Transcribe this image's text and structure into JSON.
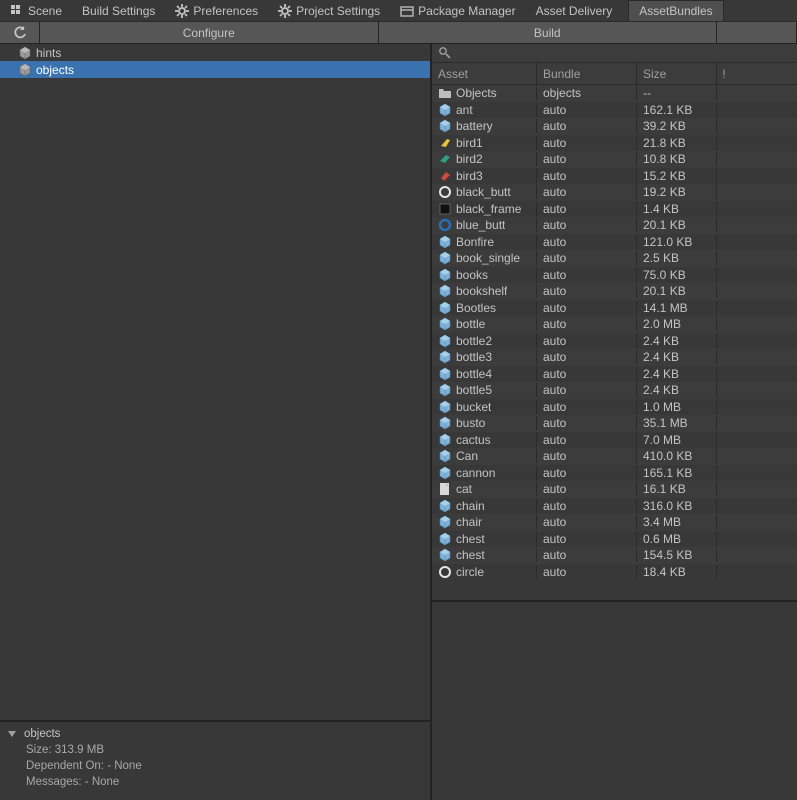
{
  "menu": {
    "scene": "Scene",
    "build_settings": "Build Settings",
    "preferences": "Preferences",
    "project_settings": "Project Settings",
    "package_manager": "Package Manager",
    "asset_delivery": "Asset Delivery",
    "asset_bundles": "AssetBundles"
  },
  "toolbar": {
    "configure": "Configure",
    "build": "Build"
  },
  "sidebar": {
    "items": [
      {
        "name": "hints",
        "selected": false
      },
      {
        "name": "objects",
        "selected": true
      }
    ]
  },
  "details": {
    "title": "objects",
    "size_label": "Size: 313.9 MB",
    "dependent_label": "Dependent On: - None",
    "messages_label": "Messages: - None"
  },
  "table": {
    "search_placeholder": "",
    "headers": {
      "asset": "Asset",
      "bundle": "Bundle",
      "size": "Size",
      "bang": "!"
    },
    "rows": [
      {
        "icon": "folder",
        "asset": "Objects",
        "bundle": "objects",
        "size": "--"
      },
      {
        "icon": "prefab",
        "asset": "ant",
        "bundle": "auto",
        "size": "162.1 KB"
      },
      {
        "icon": "prefab",
        "asset": "battery",
        "bundle": "auto",
        "size": "39.2 KB"
      },
      {
        "icon": "bird-yellow",
        "asset": "bird1",
        "bundle": "auto",
        "size": "21.8 KB"
      },
      {
        "icon": "bird-teal",
        "asset": "bird2",
        "bundle": "auto",
        "size": "10.8 KB"
      },
      {
        "icon": "bird-red",
        "asset": "bird3",
        "bundle": "auto",
        "size": "15.2 KB"
      },
      {
        "icon": "ring-white",
        "asset": "black_butt",
        "bundle": "auto",
        "size": "19.2 KB"
      },
      {
        "icon": "square-black",
        "asset": "black_frame",
        "bundle": "auto",
        "size": "1.4 KB"
      },
      {
        "icon": "ring-blue",
        "asset": "blue_butt",
        "bundle": "auto",
        "size": "20.1 KB"
      },
      {
        "icon": "prefab",
        "asset": "Bonfire",
        "bundle": "auto",
        "size": "121.0 KB"
      },
      {
        "icon": "prefab",
        "asset": "book_single",
        "bundle": "auto",
        "size": "2.5 KB"
      },
      {
        "icon": "prefab",
        "asset": "books",
        "bundle": "auto",
        "size": "75.0 KB"
      },
      {
        "icon": "prefab",
        "asset": "bookshelf",
        "bundle": "auto",
        "size": "20.1 KB"
      },
      {
        "icon": "prefab",
        "asset": "Bootles",
        "bundle": "auto",
        "size": "14.1 MB"
      },
      {
        "icon": "prefab",
        "asset": "bottle",
        "bundle": "auto",
        "size": "2.0 MB"
      },
      {
        "icon": "prefab",
        "asset": "bottle2",
        "bundle": "auto",
        "size": "2.4 KB"
      },
      {
        "icon": "prefab",
        "asset": "bottle3",
        "bundle": "auto",
        "size": "2.4 KB"
      },
      {
        "icon": "prefab",
        "asset": "bottle4",
        "bundle": "auto",
        "size": "2.4 KB"
      },
      {
        "icon": "prefab",
        "asset": "bottle5",
        "bundle": "auto",
        "size": "2.4 KB"
      },
      {
        "icon": "prefab",
        "asset": "bucket",
        "bundle": "auto",
        "size": "1.0 MB"
      },
      {
        "icon": "prefab",
        "asset": "busto",
        "bundle": "auto",
        "size": "35.1 MB"
      },
      {
        "icon": "prefab",
        "asset": "cactus",
        "bundle": "auto",
        "size": "7.0 MB"
      },
      {
        "icon": "prefab",
        "asset": "Can",
        "bundle": "auto",
        "size": "410.0 KB"
      },
      {
        "icon": "prefab",
        "asset": "cannon",
        "bundle": "auto",
        "size": "165.1 KB"
      },
      {
        "icon": "doc",
        "asset": "cat",
        "bundle": "auto",
        "size": "16.1 KB"
      },
      {
        "icon": "prefab",
        "asset": "chain",
        "bundle": "auto",
        "size": "316.0 KB"
      },
      {
        "icon": "prefab",
        "asset": "chair",
        "bundle": "auto",
        "size": "3.4 MB"
      },
      {
        "icon": "prefab",
        "asset": "chest",
        "bundle": "auto",
        "size": "0.6 MB"
      },
      {
        "icon": "prefab",
        "asset": "chest",
        "bundle": "auto",
        "size": "154.5 KB"
      },
      {
        "icon": "ring-white",
        "asset": "circle",
        "bundle": "auto",
        "size": "18.4 KB"
      }
    ]
  }
}
